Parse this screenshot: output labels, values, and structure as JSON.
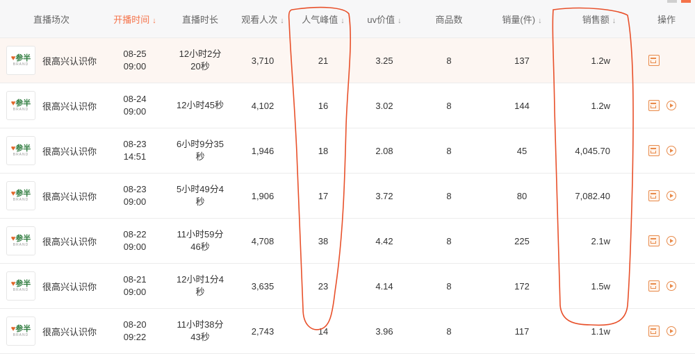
{
  "headers": {
    "session": "直播场次",
    "start_time": "开播时间",
    "duration": "直播时长",
    "viewers": "观看人次",
    "peak": "人气峰值",
    "uv_value": "uv价值",
    "products": "商品数",
    "sales_count": "销量(件)",
    "sales_amount": "销售额",
    "ops": "操作"
  },
  "sort_arrow": "↓",
  "logo": {
    "brand": "参半",
    "sub": "BRAND"
  },
  "rows": [
    {
      "name": "很高兴认识你",
      "date": "08-25",
      "time": "09:00",
      "duration": "12小时2分20秒",
      "viewers": "3,710",
      "peak": "21",
      "uv": "3.25",
      "products": "8",
      "sales": "137",
      "amount": "1.2w",
      "has_play": false
    },
    {
      "name": "很高兴认识你",
      "date": "08-24",
      "time": "09:00",
      "duration": "12小时45秒",
      "viewers": "4,102",
      "peak": "16",
      "uv": "3.02",
      "products": "8",
      "sales": "144",
      "amount": "1.2w",
      "has_play": true
    },
    {
      "name": "很高兴认识你",
      "date": "08-23",
      "time": "14:51",
      "duration": "6小时9分35秒",
      "viewers": "1,946",
      "peak": "18",
      "uv": "2.08",
      "products": "8",
      "sales": "45",
      "amount": "4,045.70",
      "has_play": true
    },
    {
      "name": "很高兴认识你",
      "date": "08-23",
      "time": "09:00",
      "duration": "5小时49分4秒",
      "viewers": "1,906",
      "peak": "17",
      "uv": "3.72",
      "products": "8",
      "sales": "80",
      "amount": "7,082.40",
      "has_play": true
    },
    {
      "name": "很高兴认识你",
      "date": "08-22",
      "time": "09:00",
      "duration": "11小时59分46秒",
      "viewers": "4,708",
      "peak": "38",
      "uv": "4.42",
      "products": "8",
      "sales": "225",
      "amount": "2.1w",
      "has_play": true
    },
    {
      "name": "很高兴认识你",
      "date": "08-21",
      "time": "09:00",
      "duration": "12小时1分4秒",
      "viewers": "3,635",
      "peak": "23",
      "uv": "4.14",
      "products": "8",
      "sales": "172",
      "amount": "1.5w",
      "has_play": true
    },
    {
      "name": "很高兴认识你",
      "date": "08-20",
      "time": "09:22",
      "duration": "11小时38分43秒",
      "viewers": "2,743",
      "peak": "14",
      "uv": "3.96",
      "products": "8",
      "sales": "117",
      "amount": "1.1w",
      "has_play": true
    }
  ],
  "colors": {
    "accent": "#f5734a",
    "annotation": "#e8502a",
    "icon": "#e88a4a"
  }
}
